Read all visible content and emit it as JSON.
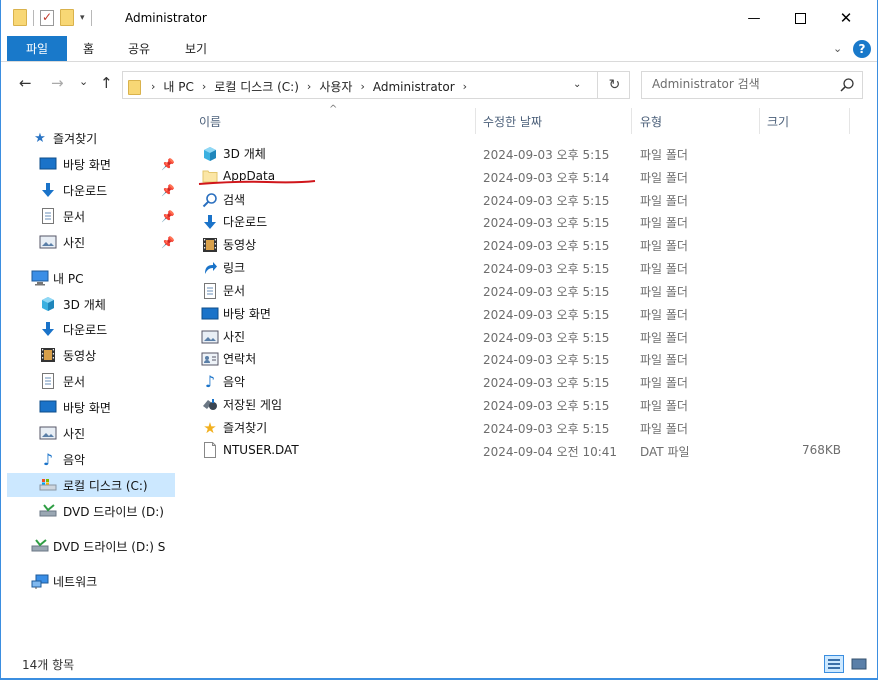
{
  "window": {
    "title": "Administrator",
    "minimize_glyph": "—",
    "close_glyph": "✕"
  },
  "ribbon": {
    "tabs": [
      "파일",
      "홈",
      "공유",
      "보기"
    ],
    "help_glyph": "?"
  },
  "nav": {
    "back_glyph": "←",
    "forward_glyph": "→",
    "recent_glyph": "⌄",
    "up_glyph": "↑",
    "refresh_glyph": "↻",
    "breadcrumb": [
      "내 PC",
      "로컬 디스크 (C:)",
      "사용자",
      "Administrator"
    ],
    "search_placeholder": "Administrator 검색"
  },
  "sidebar": {
    "items": [
      {
        "label": "즐겨찾기",
        "icon": "star-icon"
      },
      {
        "label": "바탕 화면",
        "icon": "desktop-icon",
        "pinned": true
      },
      {
        "label": "다운로드",
        "icon": "download-icon",
        "pinned": true
      },
      {
        "label": "문서",
        "icon": "document-icon",
        "pinned": true
      },
      {
        "label": "사진",
        "icon": "pictures-icon",
        "pinned": true
      },
      {
        "label": "내 PC",
        "icon": "computer-icon"
      },
      {
        "label": "3D 개체",
        "icon": "cube-icon"
      },
      {
        "label": "다운로드",
        "icon": "download-icon"
      },
      {
        "label": "동영상",
        "icon": "video-icon"
      },
      {
        "label": "문서",
        "icon": "document-icon"
      },
      {
        "label": "바탕 화면",
        "icon": "desktop-icon"
      },
      {
        "label": "사진",
        "icon": "pictures-icon"
      },
      {
        "label": "음악",
        "icon": "music-icon"
      },
      {
        "label": "로컬 디스크 (C:)",
        "icon": "drive-icon",
        "selected": true
      },
      {
        "label": "DVD 드라이브 (D:)",
        "icon": "dvd-icon"
      },
      {
        "label": "DVD 드라이브 (D:) S",
        "icon": "dvd-icon"
      },
      {
        "label": "네트워크",
        "icon": "network-icon"
      }
    ]
  },
  "columns": {
    "name": "이름",
    "date": "수정한 날짜",
    "type": "유형",
    "size": "크기"
  },
  "files": [
    {
      "name": "3D 개체",
      "date": "2024-09-03 오후 5:15",
      "type": "파일 폴더",
      "size": "",
      "icon": "cube-icon"
    },
    {
      "name": "AppData",
      "date": "2024-09-03 오후 5:14",
      "type": "파일 폴더",
      "size": "",
      "icon": "folder-icon",
      "annotated": true
    },
    {
      "name": "검색",
      "date": "2024-09-03 오후 5:15",
      "type": "파일 폴더",
      "size": "",
      "icon": "search-icon"
    },
    {
      "name": "다운로드",
      "date": "2024-09-03 오후 5:15",
      "type": "파일 폴더",
      "size": "",
      "icon": "download-icon"
    },
    {
      "name": "동영상",
      "date": "2024-09-03 오후 5:15",
      "type": "파일 폴더",
      "size": "",
      "icon": "video-icon"
    },
    {
      "name": "링크",
      "date": "2024-09-03 오후 5:15",
      "type": "파일 폴더",
      "size": "",
      "icon": "link-icon"
    },
    {
      "name": "문서",
      "date": "2024-09-03 오후 5:15",
      "type": "파일 폴더",
      "size": "",
      "icon": "document-icon"
    },
    {
      "name": "바탕 화면",
      "date": "2024-09-03 오후 5:15",
      "type": "파일 폴더",
      "size": "",
      "icon": "desktop-icon"
    },
    {
      "name": "사진",
      "date": "2024-09-03 오후 5:15",
      "type": "파일 폴더",
      "size": "",
      "icon": "pictures-icon"
    },
    {
      "name": "연락처",
      "date": "2024-09-03 오후 5:15",
      "type": "파일 폴더",
      "size": "",
      "icon": "contacts-icon"
    },
    {
      "name": "음악",
      "date": "2024-09-03 오후 5:15",
      "type": "파일 폴더",
      "size": "",
      "icon": "music-icon"
    },
    {
      "name": "저장된 게임",
      "date": "2024-09-03 오후 5:15",
      "type": "파일 폴더",
      "size": "",
      "icon": "games-icon"
    },
    {
      "name": "즐겨찾기",
      "date": "2024-09-03 오후 5:15",
      "type": "파일 폴더",
      "size": "",
      "icon": "star-icon"
    },
    {
      "name": "NTUSER.DAT",
      "date": "2024-09-04 오전 10:41",
      "type": "DAT 파일",
      "size": "768KB",
      "icon": "file-icon"
    }
  ],
  "status": {
    "item_count": "14개 항목"
  },
  "colors": {
    "accent": "#1979ca",
    "selection": "#cce8ff",
    "annotation_red": "#d0161b",
    "folder_yellow": "#f8d775"
  }
}
